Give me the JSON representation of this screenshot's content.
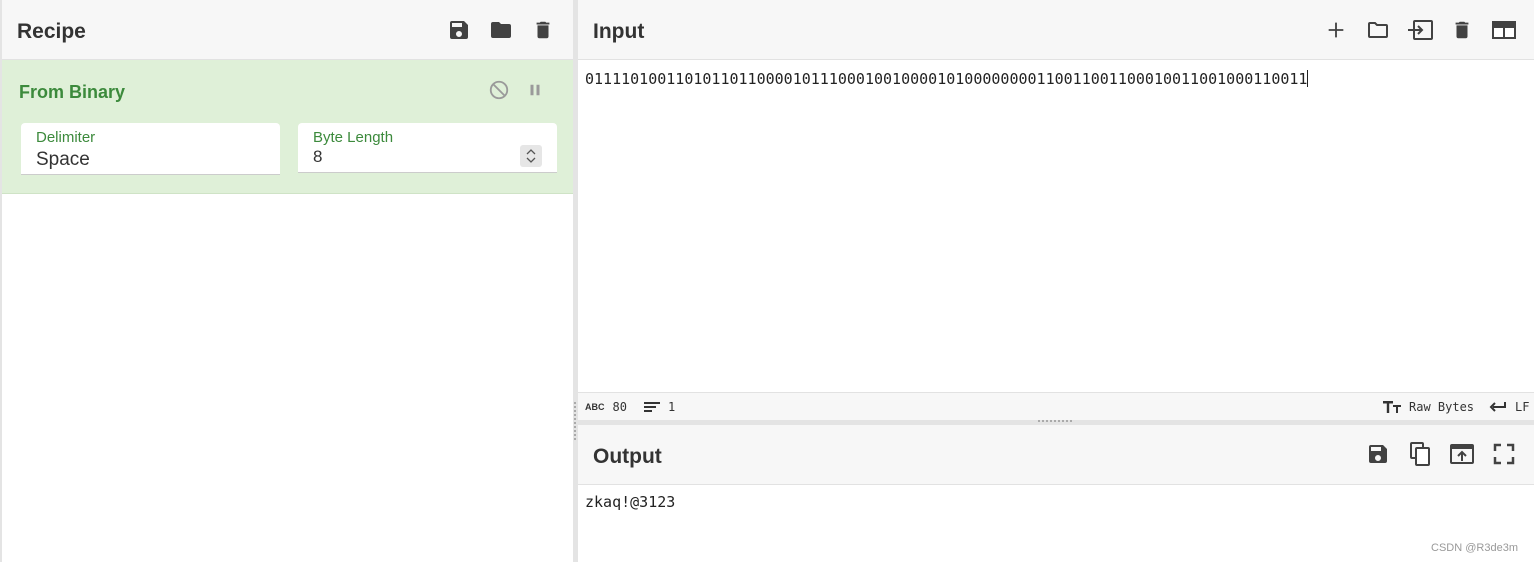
{
  "recipe": {
    "title": "Recipe",
    "icons": [
      "save-icon",
      "folder-icon",
      "trash-icon"
    ],
    "operation": {
      "name": "From Binary",
      "delimiter_label": "Delimiter",
      "delimiter_value": "Space",
      "byte_length_label": "Byte Length",
      "byte_length_value": "8"
    }
  },
  "input": {
    "title": "Input",
    "value": "01111010011010110110000101110001001000010100000000110011001100010011001000110011",
    "status": {
      "char_count": "80",
      "line_count": "1",
      "encoding": "Raw Bytes",
      "eol": "LF"
    }
  },
  "output": {
    "title": "Output",
    "value": "zkaq!@3123"
  },
  "watermark": "CSDN @R3de3m",
  "colors": {
    "accent_green": "#3c8a3c",
    "operation_bg": "#dff0d8",
    "icon": "#424242"
  }
}
